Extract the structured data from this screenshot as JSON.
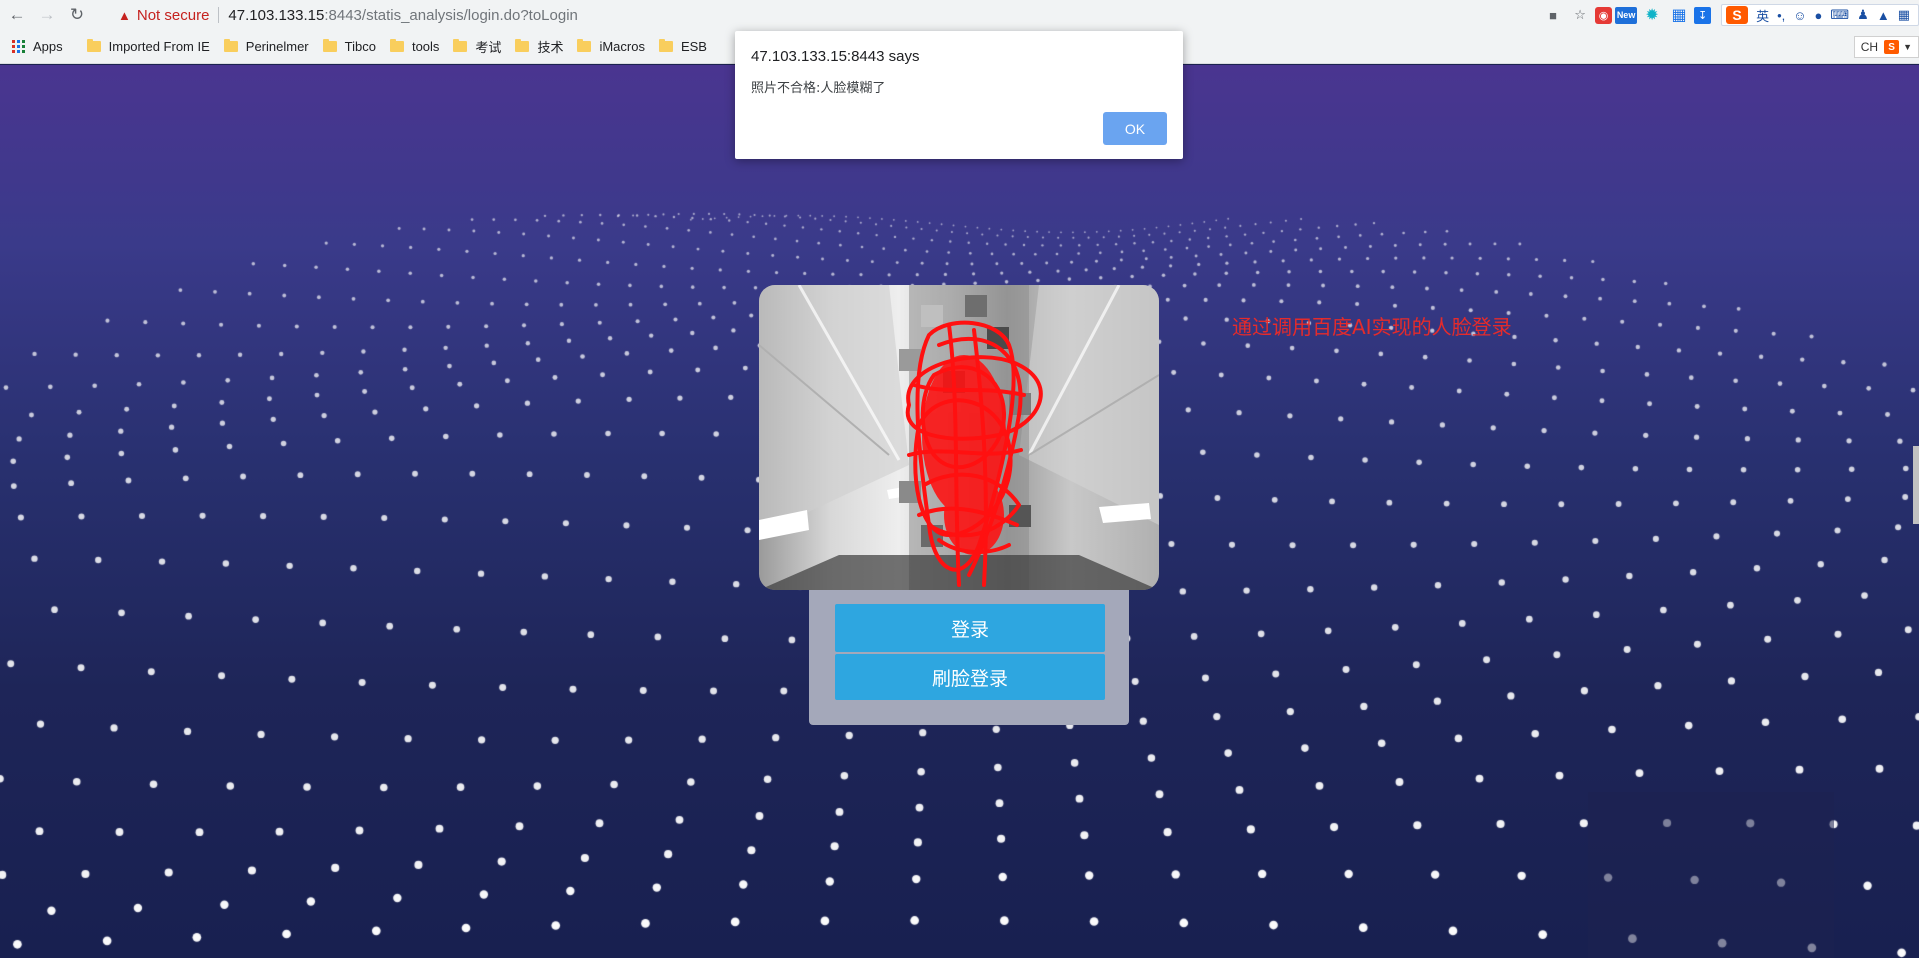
{
  "browser": {
    "url_host": "47.103.133.15",
    "url_rest": ":8443/statis_analysis/login.do?toLogin",
    "security_label": "Not secure",
    "ime_lang": "英",
    "ime_punct": "•,",
    "input_indicator": "CH"
  },
  "bookmarks": {
    "items": [
      {
        "label": "Apps"
      },
      {
        "label": "Imported From IE"
      },
      {
        "label": "Perinelmer"
      },
      {
        "label": "Tibco"
      },
      {
        "label": "tools"
      },
      {
        "label": "考试"
      },
      {
        "label": "技术"
      },
      {
        "label": "iMacros"
      },
      {
        "label": "ESB"
      }
    ]
  },
  "page": {
    "annotation": "通过调用百度AI实现的人脸登录",
    "login_button": "登录",
    "face_login_button": "刷脸登录"
  },
  "dialog": {
    "title": "47.103.133.15:8443 says",
    "message": "照片不合格:人脸模糊了",
    "ok_label": "OK"
  },
  "colors": {
    "accent_button": "#2ea6e0",
    "annotation_red": "#e52b2b",
    "dialog_ok": "#6aa4f0"
  }
}
